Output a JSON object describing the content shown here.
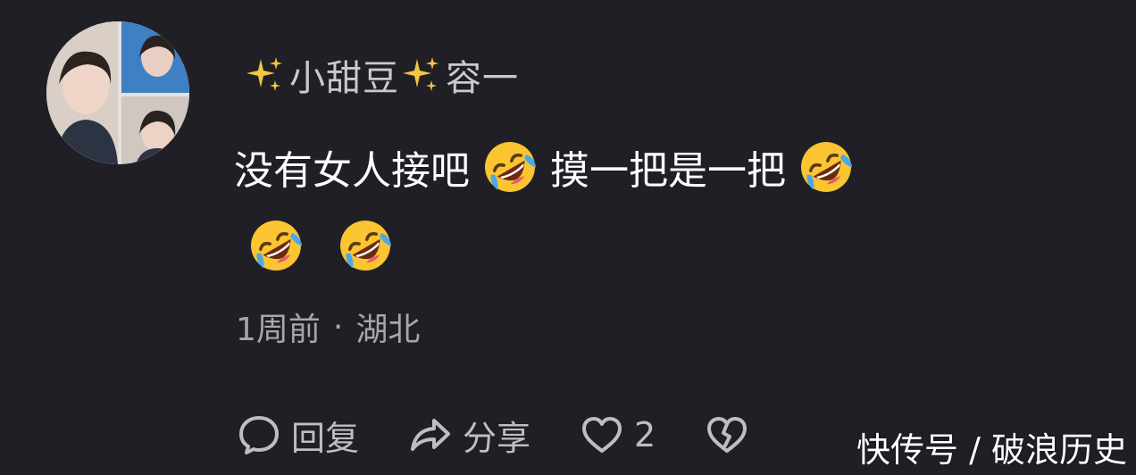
{
  "comment": {
    "username": {
      "prefix_icon": "sparkles-icon",
      "name": "小甜豆",
      "middle_icon": "sparkles-icon",
      "suffix": "容一"
    },
    "text": {
      "part1": "没有女人接吧",
      "part2": "摸一把是一把",
      "emoji": "rolling-on-floor-laughing-icon"
    },
    "meta": {
      "time": "1周前",
      "separator": "·",
      "location": "湖北"
    },
    "actions": {
      "reply_label": "回复",
      "share_label": "分享",
      "like_count": "2"
    }
  },
  "watermark": "快传号 / 破浪历史",
  "colors": {
    "background": "#1f1f25",
    "username": "#c9c9cf",
    "meta": "#a6a6ae",
    "sparkle": "#f5c542",
    "emoji_face": "#fbc531"
  }
}
